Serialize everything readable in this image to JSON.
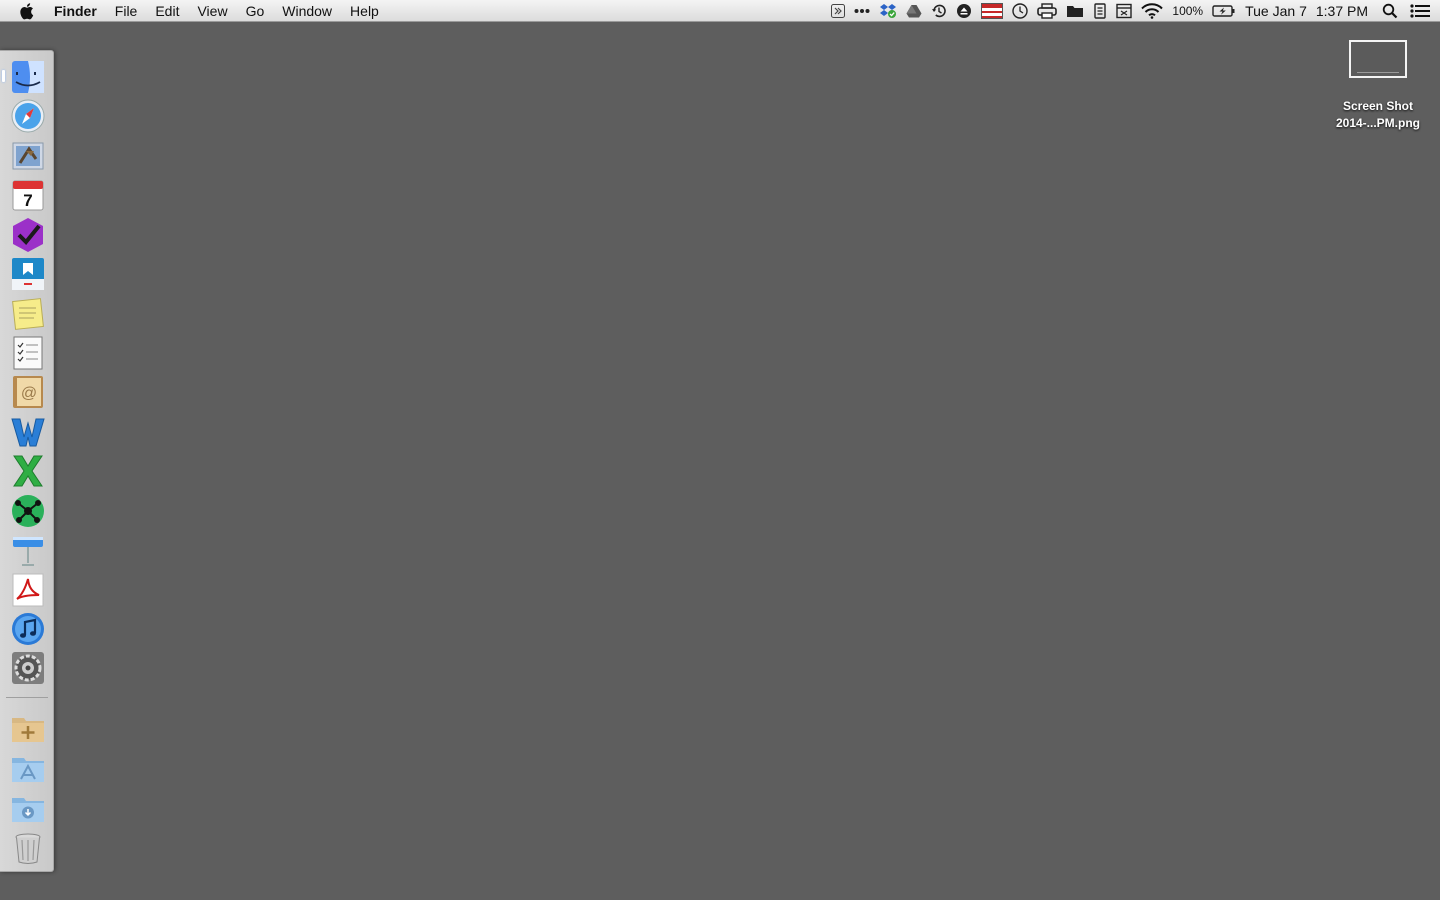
{
  "menubar": {
    "app_name": "Finder",
    "menus": [
      "File",
      "Edit",
      "View",
      "Go",
      "Window",
      "Help"
    ],
    "status": {
      "battery_percent": "100%",
      "date": "Tue Jan 7",
      "time": "1:37 PM"
    }
  },
  "dock": {
    "apps": [
      {
        "name": "finder-icon",
        "running": true
      },
      {
        "name": "safari-icon",
        "running": false
      },
      {
        "name": "mail-icon",
        "running": false
      },
      {
        "name": "calendar-icon",
        "running": false,
        "day": "7"
      },
      {
        "name": "omnifocus-icon",
        "running": false
      },
      {
        "name": "dropbox-app-icon",
        "running": false
      },
      {
        "name": "stickies-icon",
        "running": false
      },
      {
        "name": "reminders-icon",
        "running": false
      },
      {
        "name": "contacts-icon",
        "running": false
      },
      {
        "name": "word-icon",
        "running": false
      },
      {
        "name": "excel-icon",
        "running": false
      },
      {
        "name": "mindmap-icon",
        "running": false
      },
      {
        "name": "keynote-icon",
        "running": false
      },
      {
        "name": "acrobat-icon",
        "running": false
      },
      {
        "name": "itunes-icon",
        "running": false
      },
      {
        "name": "system-preferences-icon",
        "running": false
      }
    ],
    "stacks": [
      {
        "name": "stack-folder-icon"
      },
      {
        "name": "applications-folder-icon"
      },
      {
        "name": "downloads-folder-icon"
      },
      {
        "name": "trash-icon"
      }
    ]
  },
  "desktop": {
    "file": {
      "line1": "Screen Shot",
      "line2": "2014-...PM.png"
    }
  },
  "colors": {
    "desktop_bg": "#5e5e5e",
    "menubar_bg": "#e8e8e8",
    "dock_bg": "#d2d2d2"
  }
}
